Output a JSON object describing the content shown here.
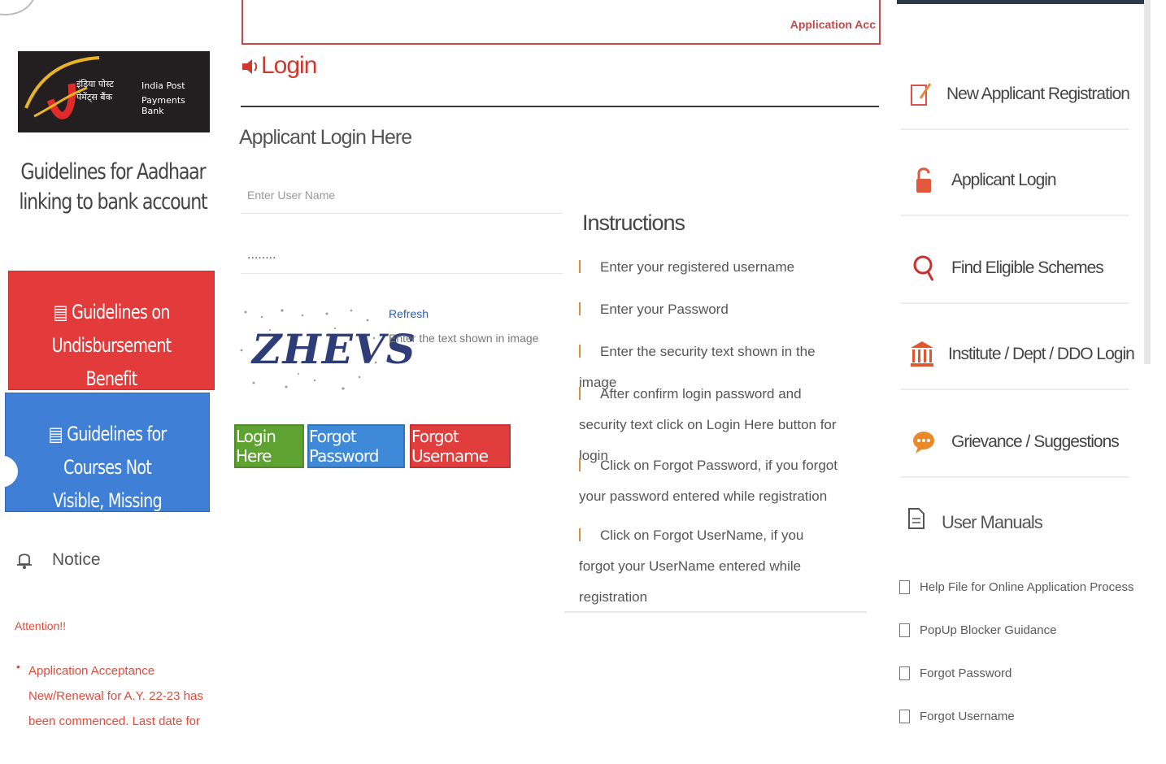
{
  "left": {
    "logo": {
      "line1": "इंडिया पोस्ट",
      "line2": "पेमेंट्स बैंक",
      "line3": "India Post",
      "line4": "Payments Bank"
    },
    "aadhaar_title": "Guidelines for Aadhaar linking to bank account",
    "promo_red": {
      "line1": "Guidelines on",
      "line2": "Undisbursement Benefit"
    },
    "promo_blue": {
      "line1": "Guidelines for Courses Not",
      "line2": "Visible, Missing"
    },
    "notice_label": "Notice",
    "attention": "Attention!!",
    "notice_bullet": "•",
    "notice_text": "Application Acceptance New/Renewal for A.Y. 22-23 has been commenced. Last date for"
  },
  "center": {
    "top_frame_text": "Application Acc",
    "login_title": "Login",
    "applicant_login": "Applicant Login Here",
    "username_placeholder": "Enter User Name",
    "password_value": "........",
    "captcha": "ZHEVS",
    "refresh": "Refresh",
    "captcha_hint": "Enter the text shown in image",
    "buttons": {
      "login": "Login Here",
      "forgot_password": "Forgot Password",
      "forgot_username": "Forgot Username"
    },
    "instructions_title": "Instructions",
    "instructions": [
      "Enter your registered username",
      "Enter your Password",
      "Enter the security text shown in the image",
      "After confirm login password and security text click on Login Here button for login",
      "Click on Forgot Password, if you forgot your password entered while registration",
      "Click on Forgot UserName, if you forgot your UserName entered while registration"
    ]
  },
  "right": {
    "items": [
      {
        "label": "New Applicant Registration",
        "icon": "edit-icon"
      },
      {
        "label": "Applicant Login",
        "icon": "unlock-icon"
      },
      {
        "label": "Find Eligible Schemes",
        "icon": "search-icon"
      },
      {
        "label": "Institute / Dept / DDO Login",
        "icon": "institution-icon"
      },
      {
        "label": "Grievance / Suggestions",
        "icon": "chat-icon"
      }
    ],
    "manuals_title": "User Manuals",
    "manuals": [
      "Help File for Online Application Process",
      "PopUp Blocker Guidance",
      "Forgot Password",
      "Forgot Username"
    ]
  },
  "colors": {
    "red": "#e33b3b",
    "blue": "#3f7fd6",
    "green": "#5ea332",
    "login_title": "#cc3a2f",
    "notice_red": "#e14b3c"
  }
}
